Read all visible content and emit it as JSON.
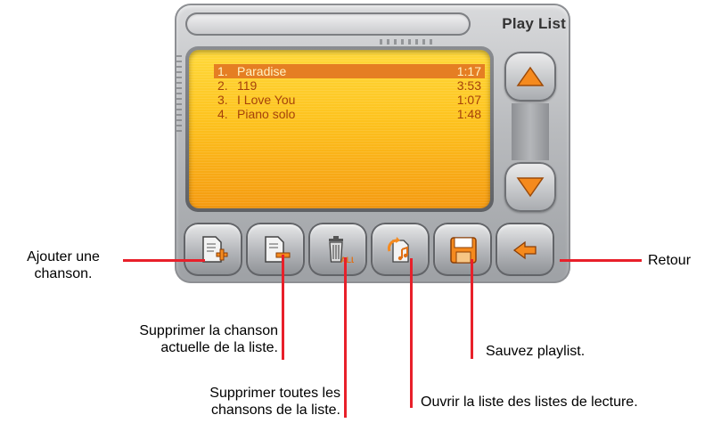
{
  "header": {
    "title": "Play List"
  },
  "playlist": [
    {
      "num": "1.",
      "name": "Paradise",
      "duration": "1:17",
      "selected": true
    },
    {
      "num": "2.",
      "name": "119",
      "duration": "3:53",
      "selected": false
    },
    {
      "num": "3.",
      "name": "I Love You",
      "duration": "1:07",
      "selected": false
    },
    {
      "num": "4.",
      "name": "Piano solo",
      "duration": "1:48",
      "selected": false
    }
  ],
  "icons": {
    "scroll_up": "up-arrow-icon",
    "scroll_down": "down-arrow-icon",
    "add": "document-plus-icon",
    "remove": "document-minus-icon",
    "delete_all": "trash-all-icon",
    "open_lists": "playlist-open-icon",
    "save": "floppy-disk-icon",
    "back": "back-arrow-icon"
  },
  "colors": {
    "accent": "#f59a10",
    "callout_line": "#e8202a",
    "selected_row": "#e57e23"
  },
  "callouts": {
    "add_line1": "Ajouter une",
    "add_line2": "chanson.",
    "remove_line1": "Supprimer la chanson",
    "remove_line2": "actuelle de la liste.",
    "delete_all_line1": "Supprimer toutes les",
    "delete_all_line2": "chansons de la liste.",
    "open_lists": "Ouvrir la liste des listes de lecture.",
    "save": "Sauvez playlist.",
    "back": "Retour"
  }
}
